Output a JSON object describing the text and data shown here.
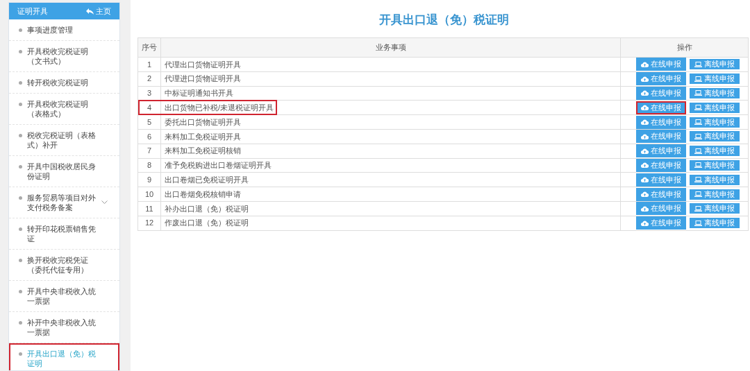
{
  "sidebar": {
    "title": "证明开具",
    "home_link": "主页",
    "items": [
      {
        "label": "事项进度管理",
        "kind": "link",
        "selected": false,
        "highlighted": false
      },
      {
        "label": "开具税收完税证明（文书式）",
        "kind": "link",
        "selected": false,
        "highlighted": false
      },
      {
        "label": "转开税收完税证明",
        "kind": "link",
        "selected": false,
        "highlighted": false
      },
      {
        "label": "开具税收完税证明（表格式）",
        "kind": "link",
        "selected": false,
        "highlighted": false
      },
      {
        "label": "税收完税证明（表格式）补开",
        "kind": "link",
        "selected": false,
        "highlighted": false
      },
      {
        "label": "开具中国税收居民身份证明",
        "kind": "link",
        "selected": false,
        "highlighted": false
      },
      {
        "label": "服务贸易等项目对外支付税务备案",
        "kind": "submenu",
        "selected": false,
        "highlighted": false
      },
      {
        "label": "转开印花税票销售凭证",
        "kind": "link",
        "selected": false,
        "highlighted": false
      },
      {
        "label": "换开税收完税凭证（委托代征专用）",
        "kind": "link",
        "selected": false,
        "highlighted": false
      },
      {
        "label": "开具中央非税收入统一票据",
        "kind": "link",
        "selected": false,
        "highlighted": false
      },
      {
        "label": "补开中央非税收入统一票据",
        "kind": "link",
        "selected": false,
        "highlighted": false
      },
      {
        "label": "开具出口退（免）税证明",
        "kind": "link",
        "selected": true,
        "highlighted": true
      }
    ]
  },
  "page_title": "开具出口退（免）税证明",
  "table": {
    "columns": [
      "序号",
      "业务事项",
      "操作"
    ],
    "rows": [
      {
        "no": "1",
        "item": "代理出口货物证明开具",
        "highlighted": false,
        "online": {
          "label": "在线申报",
          "highlighted": false
        },
        "offline": {
          "label": "离线申报"
        }
      },
      {
        "no": "2",
        "item": "代理进口货物证明开具",
        "highlighted": false,
        "online": {
          "label": "在线申报",
          "highlighted": false
        },
        "offline": {
          "label": "离线申报"
        }
      },
      {
        "no": "3",
        "item": "中标证明通知书开具",
        "highlighted": false,
        "online": {
          "label": "在线申报",
          "highlighted": false
        },
        "offline": {
          "label": "离线申报"
        }
      },
      {
        "no": "4",
        "item": "出口货物已补税/未退税证明开具",
        "highlighted": true,
        "online": {
          "label": "在线申报",
          "highlighted": true
        },
        "offline": {
          "label": "离线申报"
        }
      },
      {
        "no": "5",
        "item": "委托出口货物证明开具",
        "highlighted": false,
        "online": {
          "label": "在线申报",
          "highlighted": false
        },
        "offline": {
          "label": "离线申报"
        }
      },
      {
        "no": "6",
        "item": "来料加工免税证明开具",
        "highlighted": false,
        "online": {
          "label": "在线申报",
          "highlighted": false
        },
        "offline": {
          "label": "离线申报"
        }
      },
      {
        "no": "7",
        "item": "来料加工免税证明核销",
        "highlighted": false,
        "online": {
          "label": "在线申报",
          "highlighted": false
        },
        "offline": {
          "label": "离线申报"
        }
      },
      {
        "no": "8",
        "item": "准予免税购进出口卷烟证明开具",
        "highlighted": false,
        "online": {
          "label": "在线申报",
          "highlighted": false
        },
        "offline": {
          "label": "离线申报"
        }
      },
      {
        "no": "9",
        "item": "出口卷烟已免税证明开具",
        "highlighted": false,
        "online": {
          "label": "在线申报",
          "highlighted": false
        },
        "offline": {
          "label": "离线申报"
        }
      },
      {
        "no": "10",
        "item": "出口卷烟免税核销申请",
        "highlighted": false,
        "online": {
          "label": "在线申报",
          "highlighted": false
        },
        "offline": {
          "label": "离线申报"
        }
      },
      {
        "no": "11",
        "item": "补办出口退（免）税证明",
        "highlighted": false,
        "online": {
          "label": "在线申报",
          "highlighted": false
        },
        "offline": {
          "label": "离线申报"
        }
      },
      {
        "no": "12",
        "item": "作废出口退（免）税证明",
        "highlighted": false,
        "online": {
          "label": "在线申报",
          "highlighted": false
        },
        "offline": {
          "label": "离线申报"
        }
      }
    ]
  }
}
